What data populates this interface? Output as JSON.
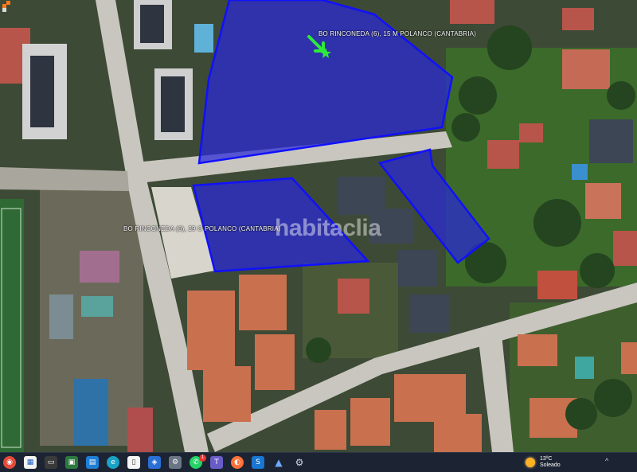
{
  "map": {
    "label_top": "BO RINCONEDA (6), 15 M POLANCO (CANTABRIA)",
    "label_bottom": "BO RINCONEDA (6), 29 O POLANCO (CANTABRIA)",
    "watermark": "habitaclia",
    "plot_fill": "#2a2ad8",
    "plot_stroke": "#1010ff"
  },
  "taskbar": {
    "icons": [
      "start-icon",
      "news-icon",
      "file-explorer-icon",
      "apps-icon",
      "photos-icon",
      "edge-icon",
      "document-icon",
      "store-icon",
      "settings-icon",
      "whatsapp-icon",
      "teams-icon",
      "firefox-icon",
      "shield-icon",
      "arrow-app-icon",
      "gear-icon"
    ],
    "notification_badge": "1",
    "weather": {
      "temperature": "13ºC",
      "condition": "Soleado"
    }
  }
}
